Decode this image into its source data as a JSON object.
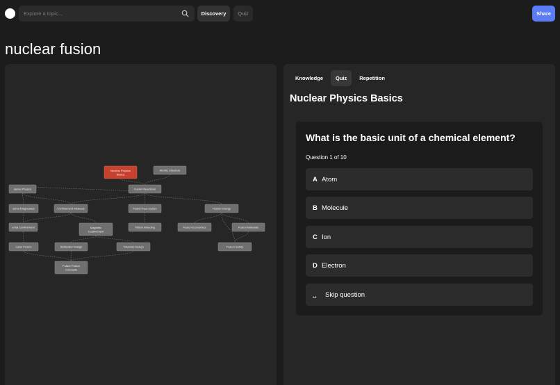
{
  "search": {
    "placeholder": "Explore a topic..."
  },
  "nav": {
    "discovery": "Discovery",
    "quiz": "Quiz"
  },
  "share_label": "Share",
  "page_title": "nuclear fusion",
  "graph": {
    "nodes": [
      {
        "id": "npb",
        "label": [
          "Nuclear Physics",
          "Basics"
        ],
        "highlighted": true
      },
      {
        "id": "as",
        "label": [
          "Atomic Structure"
        ]
      },
      {
        "id": "pp",
        "label": [
          "lasma Physics"
        ]
      },
      {
        "id": "fr",
        "label": [
          "Fusion Reactions"
        ]
      },
      {
        "id": "pd",
        "label": [
          "asma Diagnostics"
        ]
      },
      {
        "id": "cm",
        "label": [
          "Confinement Methods"
        ]
      },
      {
        "id": "ffc",
        "label": [
          "Fusion Fuel Cycles"
        ]
      },
      {
        "id": "fe",
        "label": [
          "Fusion Energy"
        ]
      },
      {
        "id": "ic",
        "label": [
          "ertial Confinement"
        ]
      },
      {
        "id": "mc",
        "label": [
          "Magnetic",
          "Confinement"
        ]
      },
      {
        "id": "tb",
        "label": [
          "Tritium Breeding"
        ]
      },
      {
        "id": "fec",
        "label": [
          "Fusion Economics"
        ]
      },
      {
        "id": "fm",
        "label": [
          "Fusion Materials"
        ]
      },
      {
        "id": "lf",
        "label": [
          "Laser Fusion"
        ]
      },
      {
        "id": "sd",
        "label": [
          "Stellarator Design"
        ]
      },
      {
        "id": "td",
        "label": [
          "Tokamak Design"
        ]
      },
      {
        "id": "fs",
        "label": [
          "Fusion Safety"
        ]
      },
      {
        "id": "ffcn",
        "label": [
          "Future Fusion",
          "Concepts"
        ]
      }
    ]
  },
  "tabs": [
    "Knowledge",
    "Quiz",
    "Repetition"
  ],
  "active_tab": "Quiz",
  "section_title": "Nuclear Physics Basics",
  "quiz": {
    "question": "What is the basic unit of a chemical element?",
    "progress": "Question 1 of 10",
    "options": [
      {
        "letter": "A",
        "text": "Atom"
      },
      {
        "letter": "B",
        "text": "Molecule"
      },
      {
        "letter": "C",
        "text": "Ion"
      },
      {
        "letter": "D",
        "text": "Electron"
      }
    ],
    "skip": {
      "icon": "␣",
      "text": "Skip question"
    }
  },
  "colors": {
    "accent": "#5b7cf5",
    "highlight_node": "#c8412f",
    "node": "#6f6f6f"
  }
}
